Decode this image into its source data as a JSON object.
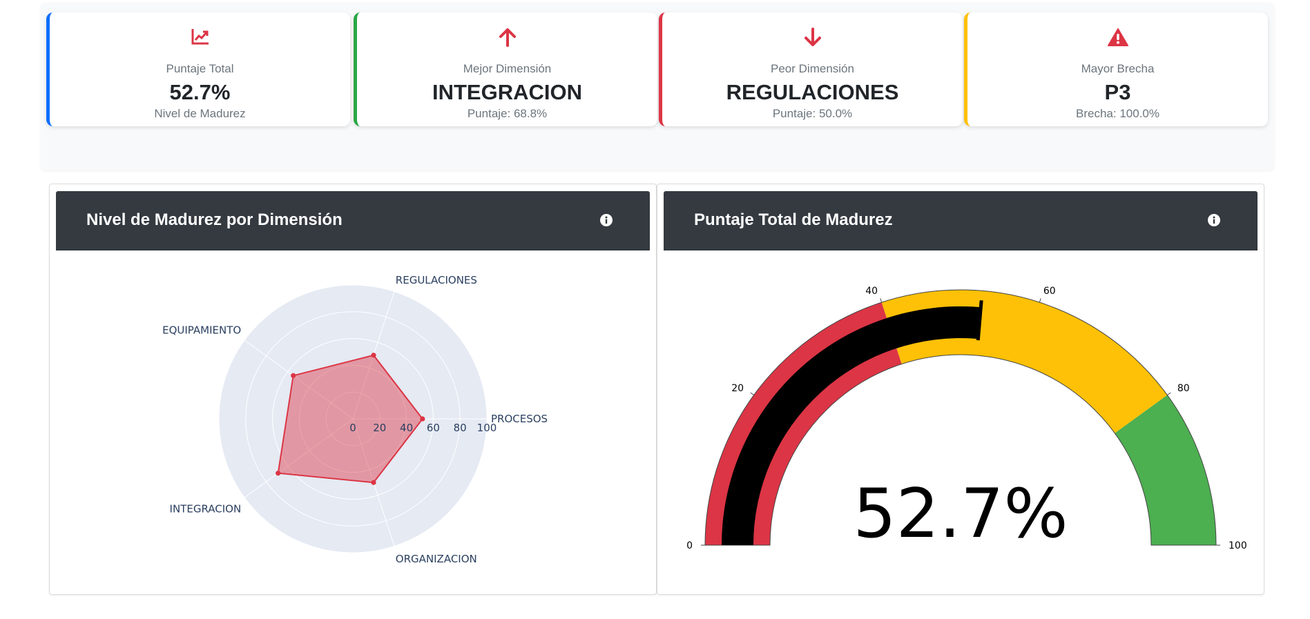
{
  "kpis": [
    {
      "icon": "chart-line-icon",
      "label": "Puntaje Total",
      "value": "52.7%",
      "sub": "Nivel de Madurez",
      "accent": "#0d6efd",
      "icon_color": "#dc3545"
    },
    {
      "icon": "arrow-up-icon",
      "label": "Mejor Dimensión",
      "value": "INTEGRACION",
      "sub": "Puntaje: 68.8%",
      "accent": "#28a745",
      "icon_color": "#dc3545"
    },
    {
      "icon": "arrow-down-icon",
      "label": "Peor Dimensión",
      "value": "REGULACIONES",
      "sub": "Puntaje: 50.0%",
      "accent": "#dc3545",
      "icon_color": "#dc3545"
    },
    {
      "icon": "warning-triangle-icon",
      "label": "Mayor Brecha",
      "value": "P3",
      "sub": "Brecha: 100.0%",
      "accent": "#ffc107",
      "icon_color": "#dc3545"
    }
  ],
  "radar_panel": {
    "title": "Nivel de Madurez por Dimensión"
  },
  "gauge_panel": {
    "title": "Puntaje Total de Madurez"
  },
  "chart_data": [
    {
      "type": "radar",
      "categories": [
        "PROCESOS",
        "REGULACIONES",
        "EQUIPAMIENTO",
        "INTEGRACION",
        "ORGANIZACION"
      ],
      "values": [
        52,
        50,
        55,
        69,
        50
      ],
      "radial_range": [
        0,
        100
      ],
      "radial_ticks": [
        "0",
        "20",
        "40",
        "60",
        "80",
        "100"
      ],
      "series_color": "#dc3545",
      "background_color": "#e5eaf3"
    },
    {
      "type": "gauge",
      "value": 52.7,
      "value_label": "52.7%",
      "range": [
        0,
        100
      ],
      "ticks": [
        "0",
        "20",
        "40",
        "60",
        "80",
        "100"
      ],
      "bands": [
        {
          "from": 0,
          "to": 40,
          "color": "#dc3545"
        },
        {
          "from": 40,
          "to": 80,
          "color": "#ffc107"
        },
        {
          "from": 80,
          "to": 100,
          "color": "#4caf50"
        }
      ],
      "bar_color": "#000000"
    }
  ]
}
